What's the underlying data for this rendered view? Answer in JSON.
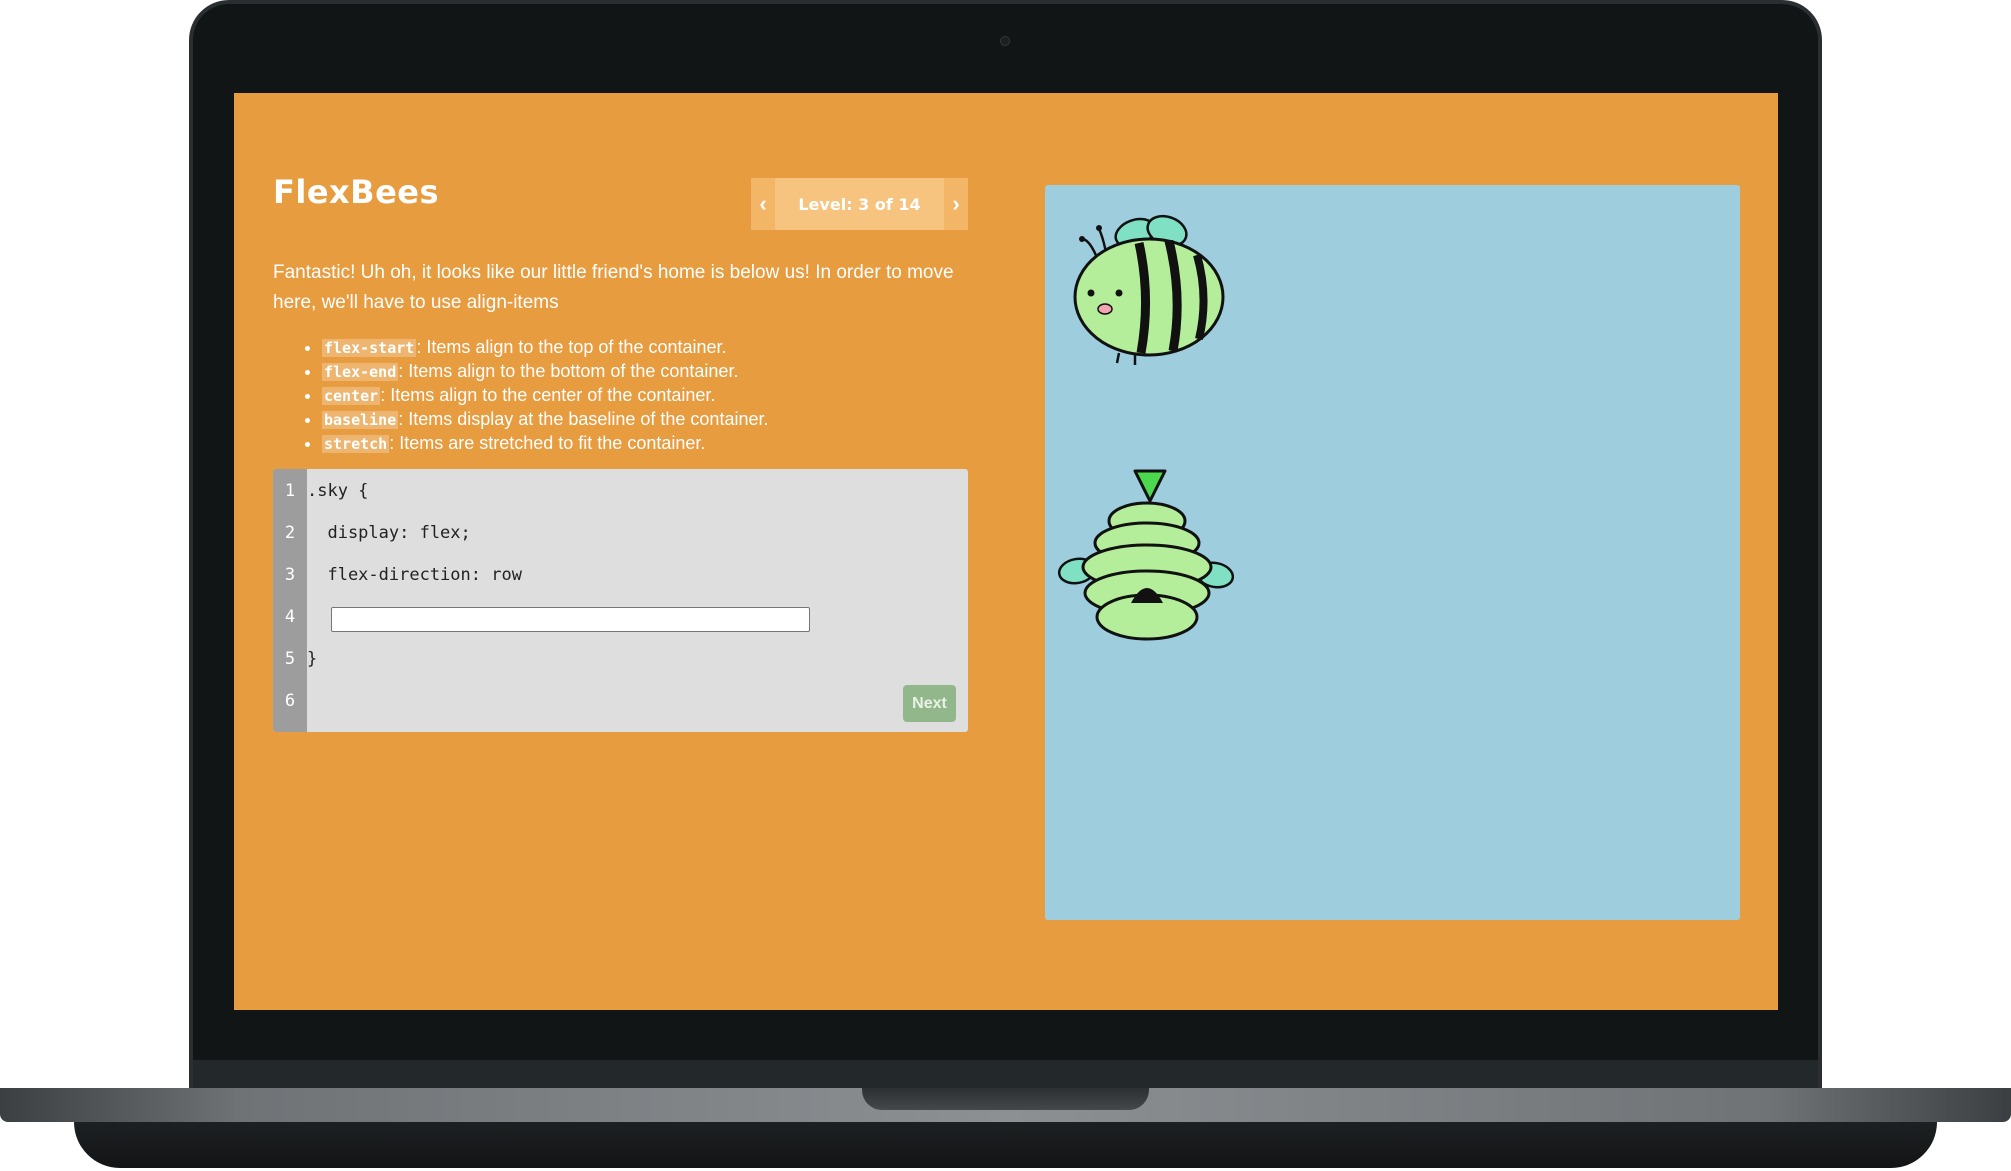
{
  "app": {
    "title": "FlexBees",
    "level_text": "Level: 3 of 14",
    "prev_icon": "chevron-left-icon",
    "next_icon": "chevron-right-icon"
  },
  "instructions": {
    "text": "Fantastic! Uh oh, it looks like our little friend's home is below us! In order to move here, we'll have to use align-items",
    "properties": [
      {
        "code": "flex-start",
        "desc": ": Items align to the top of the container."
      },
      {
        "code": "flex-end",
        "desc": ": Items align to the bottom of the container."
      },
      {
        "code": "center",
        "desc": ": Items align to the center of the container."
      },
      {
        "code": "baseline",
        "desc": ": Items display at the baseline of the container."
      },
      {
        "code": "stretch",
        "desc": ": Items are stretched to fit the container."
      }
    ]
  },
  "editor": {
    "line_numbers": [
      "1",
      "2",
      "3",
      "4",
      "5",
      "6"
    ],
    "lines": [
      ".sky {",
      "  display: flex;",
      "  flex-direction: row",
      "",
      "}",
      ""
    ],
    "answer_value": "",
    "next_label": "Next"
  },
  "colors": {
    "background": "#e89c40",
    "sky": "#9ecede",
    "editor": "#dedede",
    "gutter": "#9d9d9d",
    "next_button": "#92b78a",
    "bee_body": "#b4ee9a"
  },
  "board": {
    "items": [
      "bee-image",
      "beehive-image"
    ]
  }
}
